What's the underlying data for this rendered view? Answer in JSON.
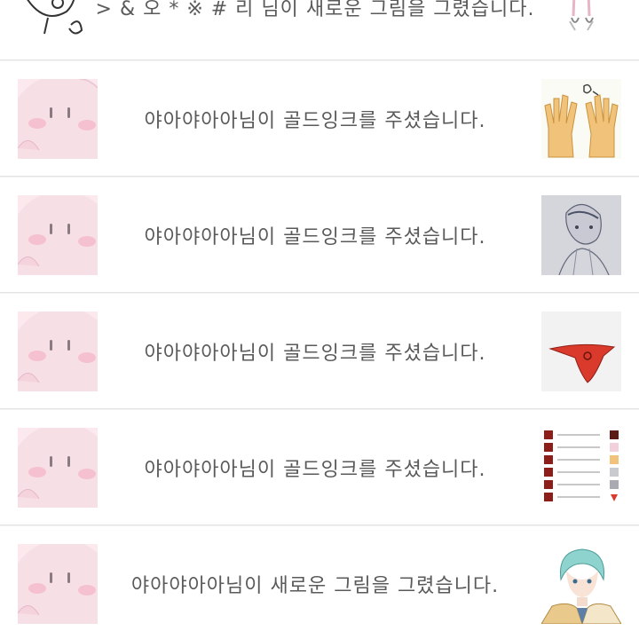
{
  "notifications": [
    {
      "avatar_icon": "sketch-face-icon",
      "message": "> & 오 * ※ # 리 님이 새로운 그림을 그렸습니다.",
      "thumbnail_icon": "figure-sketch-thumbnail"
    },
    {
      "avatar_icon": "kirby-avatar-icon",
      "message": "야아야아아님이 골드잉크를 주셨습니다.",
      "thumbnail_icon": "hands-drawing-thumbnail"
    },
    {
      "avatar_icon": "kirby-avatar-icon",
      "message": "야아야아아님이 골드잉크를 주셨습니다.",
      "thumbnail_icon": "pencil-portrait-thumbnail"
    },
    {
      "avatar_icon": "kirby-avatar-icon",
      "message": "야아야아아님이 골드잉크를 주셨습니다.",
      "thumbnail_icon": "red-cloth-thumbnail"
    },
    {
      "avatar_icon": "kirby-avatar-icon",
      "message": "야아야아아님이 골드잉크를 주셨습니다.",
      "thumbnail_icon": "notification-list-thumbnail"
    },
    {
      "avatar_icon": "kirby-avatar-icon",
      "message": "야아야아아님이 새로운 그림을 그렸습니다.",
      "thumbnail_icon": "anime-character-thumbnail"
    }
  ],
  "colors": {
    "row_background": "#ffffff",
    "divider": "#e3e3e3",
    "message_text": "#5a5a5a",
    "kirby_pink": "#f7dfe6",
    "blush": "#f4a7bd"
  }
}
